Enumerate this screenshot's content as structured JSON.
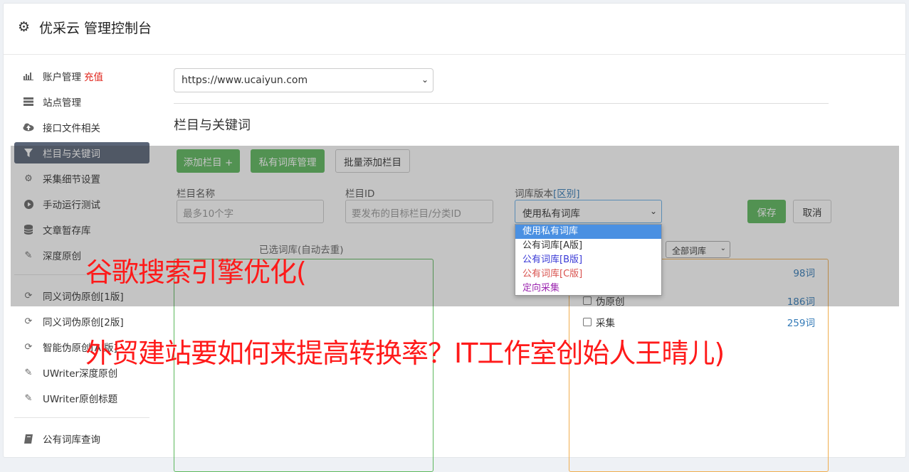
{
  "header": {
    "title": "优采云 管理控制台",
    "icon": "gear-icon"
  },
  "sidebar": {
    "group1": [
      {
        "label": "账户管理",
        "badge": "充值",
        "icon": "bar-chart-icon"
      },
      {
        "label": "站点管理",
        "icon": "server-icon"
      },
      {
        "label": "接口文件相关",
        "icon": "cloud-upload-icon"
      },
      {
        "label": "栏目与关键词",
        "icon": "filter-icon",
        "active": true
      },
      {
        "label": "采集细节设置",
        "icon": "cogs-icon"
      },
      {
        "label": "手动运行测试",
        "icon": "play-circle-icon"
      },
      {
        "label": "文章暂存库",
        "icon": "database-icon"
      },
      {
        "label": "深度原创",
        "icon": "edit-icon"
      }
    ],
    "group2": [
      {
        "label": "同义词伪原创[1版]",
        "icon": "refresh-icon"
      },
      {
        "label": "同义词伪原创[2版]",
        "icon": "refresh-icon"
      },
      {
        "label": "智能伪原创[AI版]",
        "icon": "refresh-icon"
      },
      {
        "label": "UWriter深度原创",
        "icon": "edit-icon"
      },
      {
        "label": "UWriter原创标题",
        "icon": "edit-icon"
      }
    ],
    "group3": [
      {
        "label": "公有词库查询",
        "icon": "book-icon"
      }
    ]
  },
  "main": {
    "site_select": "https://www.ucaiyun.com",
    "section_title": "栏目与关键词",
    "buttons": {
      "add_column": "添加栏目 +",
      "private_lib": "私有词库管理",
      "batch_add": "批量添加栏目",
      "save": "保存",
      "cancel": "取消"
    },
    "fields": {
      "column_name_label": "栏目名称",
      "column_name_placeholder": "最多10个字",
      "column_id_label": "栏目ID",
      "column_id_placeholder": "要发布的目标栏目/分类ID",
      "lib_version_label": "词库版本",
      "lib_version_link": "[区别]",
      "lib_version_value": "使用私有词库"
    },
    "dropdown_options": [
      "使用私有词库",
      "公有词库[A版]",
      "公有词库[B版]",
      "公有词库[C版]",
      "定向采集"
    ],
    "left_panel_caption": "已选词库(自动去重)",
    "lib_filter": "全部词库",
    "right_rows": [
      {
        "label": "",
        "count": "98词"
      },
      {
        "label": "伪原创",
        "count": "186词"
      },
      {
        "label": "采集",
        "count": "259词"
      }
    ]
  },
  "watermark": {
    "line1": "谷歌搜索引擎优化(",
    "line2": "外贸建站要如何来提高转换率？IT工作室创始人王晴儿)"
  },
  "colors": {
    "accent_green": "#5cb85c",
    "active_nav": "#5a6577",
    "badge_red": "#e0241b",
    "watermark_red": "#ff1a1a"
  }
}
